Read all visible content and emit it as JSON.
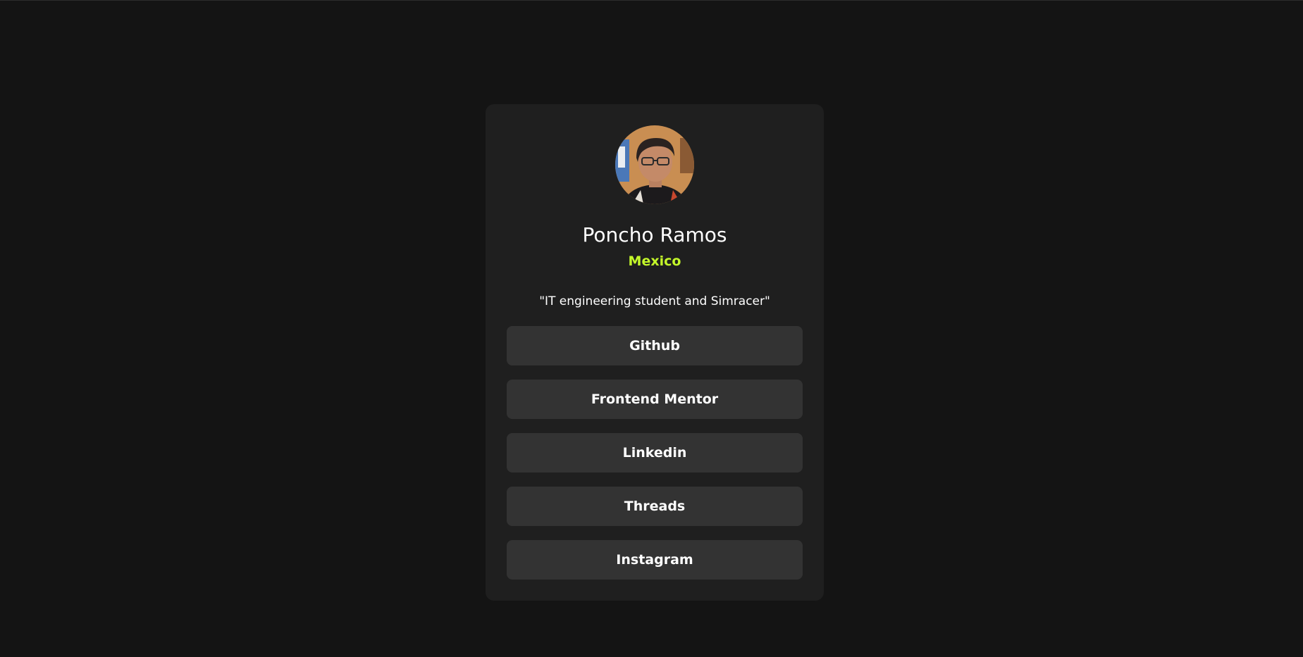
{
  "profile": {
    "avatar_alt": "Profile photo",
    "name": "Poncho Ramos",
    "location": "Mexico",
    "bio": "\"IT engineering student and Simracer\""
  },
  "links": [
    {
      "label": "Github"
    },
    {
      "label": "Frontend Mentor"
    },
    {
      "label": "Linkedin"
    },
    {
      "label": "Threads"
    },
    {
      "label": "Instagram"
    }
  ],
  "colors": {
    "page_background": "#141414",
    "card_background": "#1f1f1f",
    "button_background": "#333333",
    "accent": "#c4f82a",
    "text": "#ffffff"
  }
}
